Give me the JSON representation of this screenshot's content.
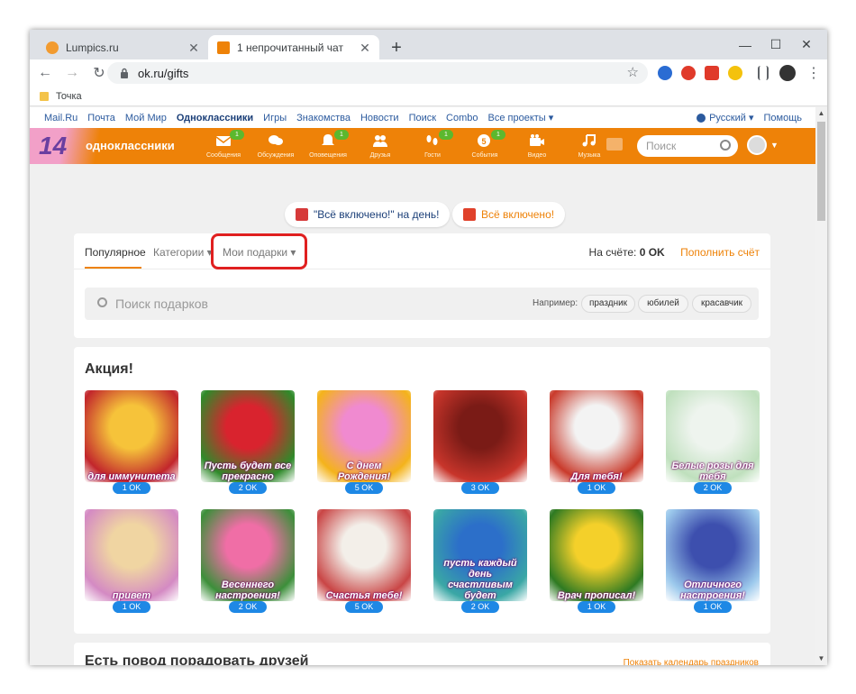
{
  "browser": {
    "tabs": [
      {
        "title": "Lumpics.ru",
        "favicon_color": "#f29b30",
        "active": false
      },
      {
        "title": "1 непрочитанный чат",
        "favicon_color": "#ee8208",
        "active": true
      }
    ],
    "new_tab_symbol": "+",
    "close_symbol": "✕",
    "window_controls": {
      "minimize": "—",
      "maximize": "☐",
      "close": "✕"
    },
    "address": "ok.ru/gifts",
    "bookmark": "Точка",
    "extension_colors": [
      "#2a6cd3",
      "#e03a2a",
      "#e03a2a",
      "#f4c20d",
      "#555555"
    ]
  },
  "portal": {
    "links": [
      "Mail.Ru",
      "Почта",
      "Мой Мир",
      "Одноклассники",
      "Игры",
      "Знакомства",
      "Новости",
      "Поиск",
      "Combo",
      "Все проекты ▾"
    ],
    "bold_index": 3,
    "language": "Русский ▾",
    "help": "Помощь"
  },
  "okheader": {
    "logo_number": "14",
    "brand": "одноклассники",
    "nav": [
      {
        "label": "Сообщения",
        "badge": "1",
        "icon": "envelope-icon"
      },
      {
        "label": "Обсуждения",
        "badge": "",
        "icon": "chat-bubbles-icon"
      },
      {
        "label": "Оповещения",
        "badge": "1",
        "icon": "bell-icon"
      },
      {
        "label": "Друзья",
        "badge": "",
        "icon": "friends-icon"
      },
      {
        "label": "Гости",
        "badge": "1",
        "icon": "footprints-icon"
      },
      {
        "label": "События",
        "badge": "1",
        "icon": "events-icon"
      },
      {
        "label": "Видео",
        "badge": "",
        "icon": "camera-icon"
      },
      {
        "label": "Музыка",
        "badge": "",
        "icon": "music-note-icon"
      }
    ],
    "search_placeholder": "Поиск"
  },
  "promos": [
    {
      "label": "\"Всё включено!\" на день!",
      "color": "#1b3f78",
      "icon_color": "#d63a3a"
    },
    {
      "label": "Всё включено!",
      "color": "#ee8208",
      "icon_color": "#e0412b"
    }
  ],
  "gift_tabs": {
    "popular": "Популярное",
    "categories": "Категории ▾",
    "my_gifts": "Мои подарки ▾",
    "balance_label": "На счёте:",
    "balance_value": "0 OK",
    "topup": "Пополнить счёт"
  },
  "gift_search": {
    "placeholder": "Поиск подарков",
    "example_label": "Например:",
    "chips": [
      "праздник",
      "юбилей",
      "красавчик"
    ]
  },
  "promo_section": {
    "title": "Акция!",
    "gifts": [
      {
        "price": "1 OK",
        "caption": "для иммунитета",
        "colors": [
          "#f6c33a",
          "#c2262c"
        ]
      },
      {
        "price": "2 OK",
        "caption": "Пусть будет все прекрасно",
        "colors": [
          "#d9232e",
          "#2f8a2a"
        ]
      },
      {
        "price": "5 OK",
        "caption": "С днем Рождения!",
        "colors": [
          "#f08ad0",
          "#f4b31b"
        ]
      },
      {
        "price": "3 OK",
        "caption": "",
        "colors": [
          "#7a1b16",
          "#c8352b"
        ]
      },
      {
        "price": "1 OK",
        "caption": "Для тебя!",
        "colors": [
          "#f3f3f3",
          "#c93a2b"
        ]
      },
      {
        "price": "2 OK",
        "caption": "Белые розы для тебя",
        "colors": [
          "#eef4ee",
          "#bfe0bd"
        ]
      },
      {
        "price": "1 OK",
        "caption": "привет",
        "colors": [
          "#f0d5a2",
          "#d48ac3"
        ]
      },
      {
        "price": "2 OK",
        "caption": "Весеннего настроения!",
        "colors": [
          "#f06ea6",
          "#3c8f3a"
        ]
      },
      {
        "price": "5 OK",
        "caption": "Счастья тебе!",
        "colors": [
          "#f3efe9",
          "#c94545"
        ]
      },
      {
        "price": "2 OK",
        "caption": "пусть каждый день счастливым будет",
        "colors": [
          "#2c6fc9",
          "#3aa7a5"
        ]
      },
      {
        "price": "1 OK",
        "caption": "Врач прописал!",
        "colors": [
          "#f4d02a",
          "#2e7a22"
        ]
      },
      {
        "price": "1 OK",
        "caption": "Отличного настроения!",
        "colors": [
          "#3d4fae",
          "#9cc9ec"
        ]
      }
    ]
  },
  "occasion_section": {
    "title": "Есть повод порадовать друзей",
    "link": "Показать календарь праздников"
  }
}
